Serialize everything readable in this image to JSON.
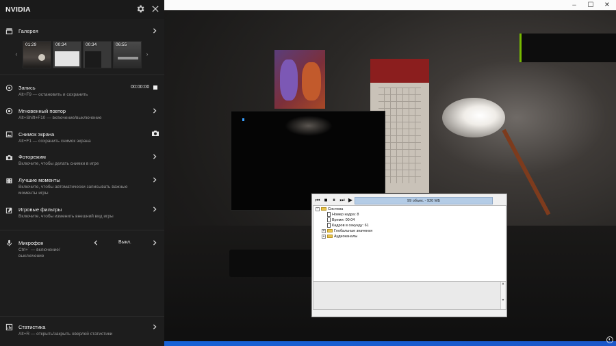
{
  "game_window": {
    "minimize_glyph": "–",
    "maximize_glyph": "☐",
    "close_glyph": "✕"
  },
  "overlay": {
    "brand": "NVIDIA",
    "settings_icon": "gear-icon",
    "close_icon": "close-icon",
    "accent_color": "#76b900"
  },
  "gallery": {
    "title": "Галерея",
    "thumbnails": [
      {
        "time": "01:29"
      },
      {
        "time": "00:34"
      },
      {
        "time": "00:34"
      },
      {
        "time": "06:55"
      }
    ]
  },
  "record": {
    "title": "Запись",
    "subtitle": "Alt+F9 — остановить и сохранить",
    "time": "00:00:00"
  },
  "instant_replay": {
    "title": "Мгновенный повтор",
    "subtitle": "Alt+Shift+F10 — включение/выключение"
  },
  "screenshot": {
    "title": "Снимок экрана",
    "subtitle": "Alt+F1 — сохранить снимок экрана"
  },
  "photo_mode": {
    "title": "Фоторежим",
    "subtitle": "Включите, чтобы делать снимки в игре"
  },
  "highlights": {
    "title": "Лучшие моменты",
    "subtitle_1": "Включите, чтобы автоматически записывать важные",
    "subtitle_2": "моменты игры"
  },
  "game_filters": {
    "title": "Игровые фильтры",
    "subtitle": "Включите, чтобы изменить внешний вид игры"
  },
  "microphone": {
    "title": "Микрофон",
    "subtitle_1": "Ctrl+` — включение/",
    "subtitle_2": "выключение",
    "value": "Выкл."
  },
  "statistics": {
    "title": "Статистика",
    "subtitle": "Alt+R — открыть/закрыть оверлей статистики"
  },
  "property_window": {
    "status": "99 объек. - 920 МБ",
    "tree": {
      "root": "Система",
      "frame_number": "Номер кадра: 8",
      "time": "Время: 00:04",
      "fps": "Кадров в секунду: 61",
      "globals": "Глобальные значения",
      "audio": "Аудиоканалы"
    }
  }
}
